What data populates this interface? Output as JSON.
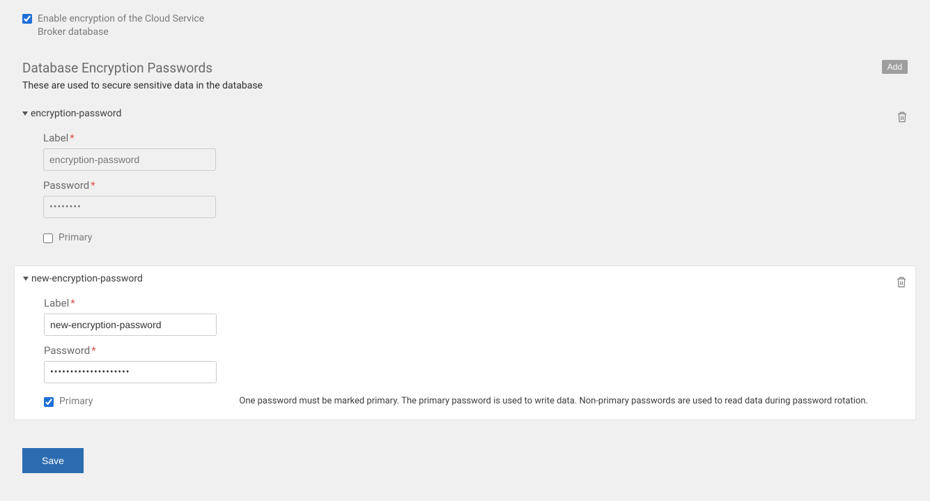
{
  "enable_encryption": {
    "label": "Enable encryption of the Cloud Service Broker database",
    "checked": true
  },
  "section": {
    "title": "Database Encryption Passwords",
    "subtitle": "These are used to secure sensitive data in the database",
    "add_label": "Add"
  },
  "labels": {
    "label": "Label",
    "password": "Password",
    "primary": "Primary",
    "required": "*"
  },
  "primary_description": "One password must be marked primary. The primary password is used to write data. Non-primary passwords are used to read data during password rotation.",
  "blocks": [
    {
      "name": "encryption-password",
      "label_value": "encryption-password",
      "password_value": "••••••••",
      "primary": false,
      "active": false
    },
    {
      "name": "new-encryption-password",
      "label_value": "new-encryption-password",
      "password_value": "••••••••••••••••••••",
      "primary": true,
      "active": true
    }
  ],
  "save_label": "Save"
}
